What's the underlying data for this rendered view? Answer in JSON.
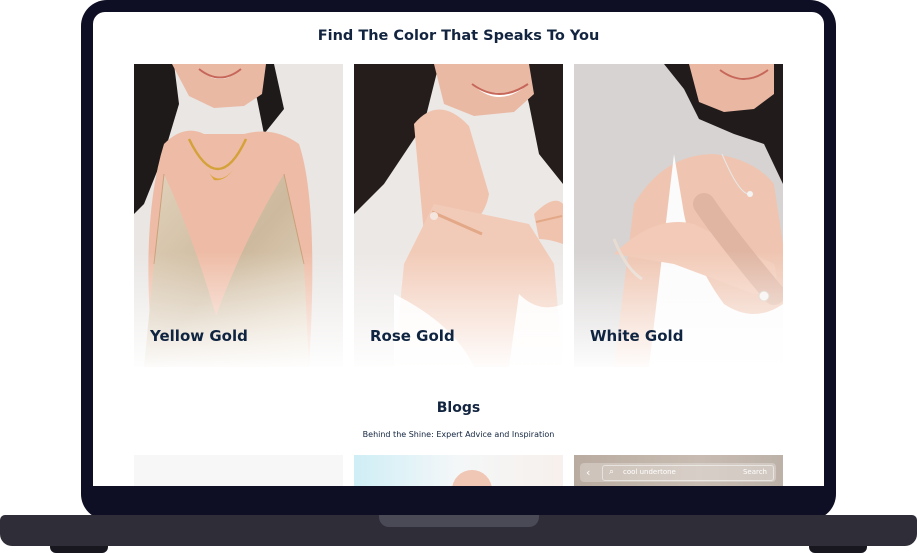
{
  "colors": {
    "frame": "#0e0e24",
    "base": "#2e2d38",
    "heading": "#12243f"
  },
  "section": {
    "title": "Find The Color That Speaks To You"
  },
  "cards": [
    {
      "label": "Yellow Gold"
    },
    {
      "label": "Rose Gold"
    },
    {
      "label": "White Gold"
    }
  ],
  "blogs": {
    "title": "Blogs",
    "subtitle": "Behind the Shine: Expert Advice and Inspiration"
  },
  "blog_search": {
    "back_icon": "chevron-left-icon",
    "search_icon": "search-icon",
    "query": "cool undertone",
    "button": "Search"
  }
}
